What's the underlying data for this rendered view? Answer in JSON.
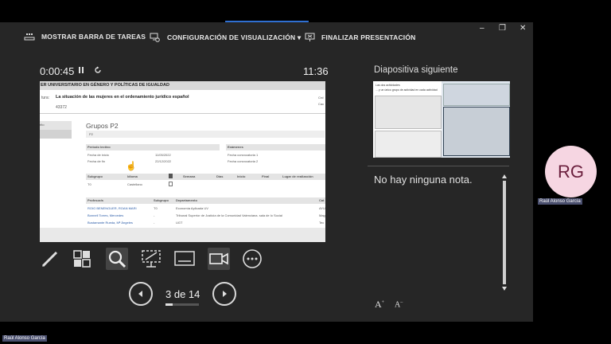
{
  "toolbar": {
    "taskbar_label": "MOSTRAR BARRA DE TAREAS",
    "display_label": "CONFIGURACIÓN DE VISUALIZACIÓN ▾",
    "end_label": "FINALIZAR PRESENTACIÓN"
  },
  "window": {
    "minimize": "–",
    "restore": "❐",
    "close": "✕"
  },
  "timer": {
    "elapsed": "0:00:45",
    "clock": "11:36"
  },
  "slide": {
    "header": "ER UNIVERSITARIO EN GÉNERO Y POLÍTICAS DE IGUALDAD",
    "field_label": "tura:",
    "field_title": "La situación de las mujeres en el ordenamiento jurídico español",
    "field_code": "43372",
    "right_col1": "Crd",
    "right_col2": "Cac",
    "left_menu": "rito",
    "group_title": "Grupos P2",
    "group_tab": "P2",
    "period_header": "Periodo lectivo",
    "period_row1_label": "Fecha de inicio",
    "period_row1_value": "11/05/2022",
    "period_row2_label": "Fecha de fin",
    "period_row2_value": "22/12/2022",
    "exam_header": "Exámenes",
    "exam_row1": "Fecha convocatoria 1",
    "exam_row2": "Fecha convocatoria 2",
    "sched_headers": [
      "Subgrupo",
      "Idioma",
      "Semana",
      "Días",
      "Inicio",
      "Final",
      "Lugar de realización"
    ],
    "sched_row": [
      "T0",
      "Castellano"
    ],
    "prof_headers": [
      "Profesor/a",
      "Subgrupo",
      "Departamento",
      "Cat"
    ],
    "prof_rows": [
      {
        "name": "ROIG BENENGUER, ROAN MARI",
        "sub": "T0",
        "dept": "Economía Aplicada UV",
        "cat": "AYU"
      },
      {
        "name": "Bonnell Torres, Mercedes",
        "sub": "-",
        "dept": "Tribunal Superior de Justicia de la Comunidad Valenciana. sala de lo Social",
        "cat": "Mag"
      },
      {
        "name": "Bustamante Rueda, Mª Ángeles",
        "sub": "-",
        "dept": "UGT",
        "cat": "Tec"
      }
    ]
  },
  "tools": [
    "pen-tool",
    "see-all-slides",
    "zoom",
    "pointer-screen",
    "subtitles",
    "camera",
    "more-options"
  ],
  "navigation": {
    "counter": "3 de 14",
    "progress_fraction": 0.214
  },
  "next": {
    "label": "Diapositiva siguiente",
    "thumb_line1": "Las dos actividades",
    "thumb_line2": "... y un único grupo de actividad en cada actividad"
  },
  "notes": {
    "text": "No hay ninguna nota."
  },
  "font_controls": {
    "increase": "A",
    "decrease": "A"
  },
  "participant": {
    "initials": "RG",
    "name": "Raúl Alonso García"
  },
  "colors": {
    "presenter_bg": "#262626",
    "accent_blue": "#2f6fd1",
    "avatar_bg": "#f6d6e2",
    "avatar_text": "#6a1e3c",
    "badge_bg": "#4a4f6e"
  }
}
